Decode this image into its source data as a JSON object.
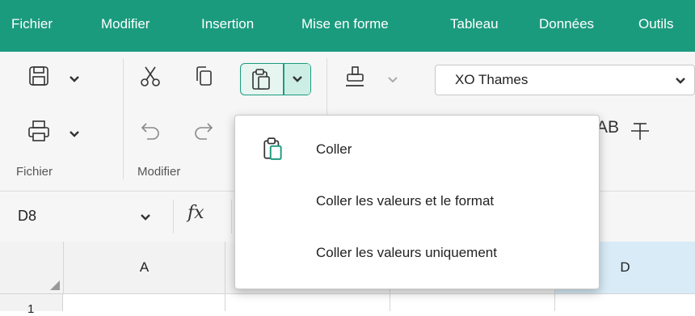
{
  "menubar": {
    "items": [
      "Fichier",
      "Modifier",
      "Insertion",
      "Mise en forme",
      "Tableau",
      "Données",
      "Outils"
    ]
  },
  "toolbar": {
    "groups": {
      "file_label": "Fichier",
      "edit_label": "Modifier"
    },
    "font_name": "XO Thames",
    "ab_text": "AB"
  },
  "formula_bar": {
    "cell_ref": "D8",
    "fx": "fx"
  },
  "grid": {
    "columns": [
      "A",
      "",
      "",
      "D"
    ],
    "rows": [
      "1"
    ]
  },
  "paste_menu": {
    "items": [
      {
        "label": "Coller",
        "icon": "paste-icon"
      },
      {
        "label": "Coller les valeurs et le format",
        "icon": ""
      },
      {
        "label": "Coller les valeurs uniquement",
        "icon": ""
      }
    ]
  },
  "colors": {
    "accent": "#1b9b7e",
    "accent_light": "#e7f5f1"
  }
}
